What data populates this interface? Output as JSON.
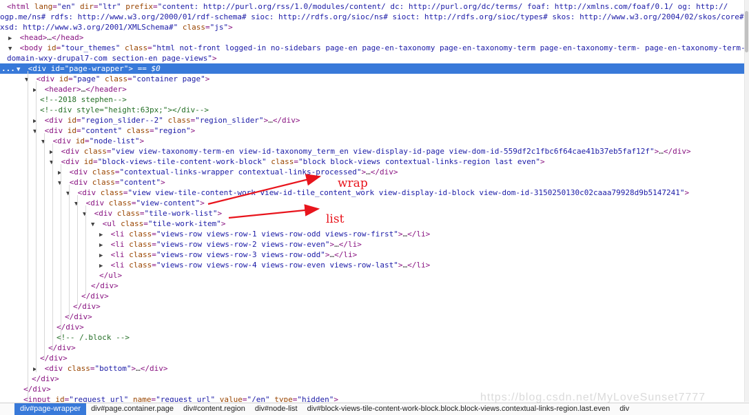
{
  "lines": [
    [
      {
        "c": "tag",
        "t": "<html "
      },
      {
        "c": "attr",
        "t": "lang"
      },
      {
        "c": "tag",
        "t": "="
      },
      {
        "c": "val",
        "t": "\"en\""
      },
      {
        "c": "attr",
        "t": " dir"
      },
      {
        "c": "tag",
        "t": "="
      },
      {
        "c": "val",
        "t": "\"ltr\""
      },
      {
        "c": "attr",
        "t": " prefix"
      },
      {
        "c": "tag",
        "t": "="
      },
      {
        "c": "val",
        "t": "\"content: http://purl.org/rss/1.0/modules/content/ dc: http://purl.org/dc/terms/ foaf: http://xmlns.com/foaf/0.1/ og: http://"
      }
    ],
    [
      {
        "c": "val",
        "t": "ogp.me/ns# rdfs: http://www.w3.org/2000/01/rdf-schema# sioc: http://rdfs.org/sioc/ns# sioct: http://rdfs.org/sioc/types# skos: http://www.w3.org/2004/02/skos/core#"
      }
    ],
    [
      {
        "c": "val",
        "t": "xsd: http://www.w3.org/2001/XMLSchema#\""
      },
      {
        "c": "attr",
        "t": " class"
      },
      {
        "c": "tag",
        "t": "="
      },
      {
        "c": "val",
        "t": "\"js\""
      },
      {
        "c": "tag",
        "t": ">"
      }
    ],
    [
      {
        "c": "tag",
        "t": "<head>"
      },
      {
        "c": "ell",
        "t": "…"
      },
      {
        "c": "tag",
        "t": "</head>"
      }
    ],
    [
      {
        "c": "tag",
        "t": "<body "
      },
      {
        "c": "attr",
        "t": "id"
      },
      {
        "c": "tag",
        "t": "="
      },
      {
        "c": "val",
        "t": "\"tour_themes\""
      },
      {
        "c": "attr",
        "t": " class"
      },
      {
        "c": "tag",
        "t": "="
      },
      {
        "c": "val",
        "t": "\"html not-front logged-in no-sidebars page-en page-en-taxonomy page-en-taxonomy-term page-en-taxonomy-term- page-en-taxonomy-term-55"
      }
    ],
    [
      {
        "c": "val",
        "t": "domain-wxy-drupal7-com section-en page-views\""
      },
      {
        "c": "tag",
        "t": ">"
      }
    ],
    [
      {
        "c": "tag",
        "t": "<div "
      },
      {
        "c": "attr",
        "t": "id"
      },
      {
        "c": "tag",
        "t": "="
      },
      {
        "c": "val",
        "t": "\"page-wrapper\""
      },
      {
        "c": "tag",
        "t": ">"
      },
      {
        "c": "dollar",
        "t": " == $0"
      }
    ],
    [
      {
        "c": "tag",
        "t": "<div "
      },
      {
        "c": "attr",
        "t": "id"
      },
      {
        "c": "tag",
        "t": "="
      },
      {
        "c": "val",
        "t": "\"page\""
      },
      {
        "c": "attr",
        "t": " class"
      },
      {
        "c": "tag",
        "t": "="
      },
      {
        "c": "val",
        "t": "\"container page\""
      },
      {
        "c": "tag",
        "t": ">"
      }
    ],
    [
      {
        "c": "tag",
        "t": "<header>"
      },
      {
        "c": "ell",
        "t": "…"
      },
      {
        "c": "tag",
        "t": "</header>"
      }
    ],
    [
      {
        "c": "cm",
        "t": "<!--2018 stephen-->"
      }
    ],
    [
      {
        "c": "cm",
        "t": "<!--div style=\"height:63px;\"></div-->"
      }
    ],
    [
      {
        "c": "tag",
        "t": "<div "
      },
      {
        "c": "attr",
        "t": "id"
      },
      {
        "c": "tag",
        "t": "="
      },
      {
        "c": "val",
        "t": "\"region_slider--2\""
      },
      {
        "c": "attr",
        "t": " class"
      },
      {
        "c": "tag",
        "t": "="
      },
      {
        "c": "val",
        "t": "\"region_slider\""
      },
      {
        "c": "tag",
        "t": ">"
      },
      {
        "c": "ell",
        "t": "…"
      },
      {
        "c": "tag",
        "t": "</div>"
      }
    ],
    [
      {
        "c": "tag",
        "t": "<div "
      },
      {
        "c": "attr",
        "t": "id"
      },
      {
        "c": "tag",
        "t": "="
      },
      {
        "c": "val",
        "t": "\"content\""
      },
      {
        "c": "attr",
        "t": " class"
      },
      {
        "c": "tag",
        "t": "="
      },
      {
        "c": "val",
        "t": "\"region\""
      },
      {
        "c": "tag",
        "t": ">"
      }
    ],
    [
      {
        "c": "tag",
        "t": "<div "
      },
      {
        "c": "attr",
        "t": "id"
      },
      {
        "c": "tag",
        "t": "="
      },
      {
        "c": "val",
        "t": "\"node-list\""
      },
      {
        "c": "tag",
        "t": ">"
      }
    ],
    [
      {
        "c": "tag",
        "t": "<div "
      },
      {
        "c": "attr",
        "t": "class"
      },
      {
        "c": "tag",
        "t": "="
      },
      {
        "c": "val",
        "t": "\"view view-taxonomy-term-en view-id-taxonomy_term_en view-display-id-page view-dom-id-559df2c1fbc6f64cae41b37eb5faf12f\""
      },
      {
        "c": "tag",
        "t": ">"
      },
      {
        "c": "ell",
        "t": "…"
      },
      {
        "c": "tag",
        "t": "</div>"
      }
    ],
    [
      {
        "c": "tag",
        "t": "<div "
      },
      {
        "c": "attr",
        "t": "id"
      },
      {
        "c": "tag",
        "t": "="
      },
      {
        "c": "val",
        "t": "\"block-views-tile-content-work-block\""
      },
      {
        "c": "attr",
        "t": " class"
      },
      {
        "c": "tag",
        "t": "="
      },
      {
        "c": "val",
        "t": "\"block block-views contextual-links-region last even\""
      },
      {
        "c": "tag",
        "t": ">"
      }
    ],
    [
      {
        "c": "tag",
        "t": "<div "
      },
      {
        "c": "attr",
        "t": "class"
      },
      {
        "c": "tag",
        "t": "="
      },
      {
        "c": "val",
        "t": "\"contextual-links-wrapper contextual-links-processed\""
      },
      {
        "c": "tag",
        "t": ">"
      },
      {
        "c": "ell",
        "t": "…"
      },
      {
        "c": "tag",
        "t": "</div>"
      }
    ],
    [
      {
        "c": "tag",
        "t": "<div "
      },
      {
        "c": "attr",
        "t": "class"
      },
      {
        "c": "tag",
        "t": "="
      },
      {
        "c": "val",
        "t": "\"content\""
      },
      {
        "c": "tag",
        "t": ">"
      }
    ],
    [
      {
        "c": "tag",
        "t": "<div "
      },
      {
        "c": "attr",
        "t": "class"
      },
      {
        "c": "tag",
        "t": "="
      },
      {
        "c": "val",
        "t": "\"view view-tile-content-work view-id-tile_content_work view-display-id-block view-dom-id-3150250130c02caaa79928d9b5147241\""
      },
      {
        "c": "tag",
        "t": ">"
      }
    ],
    [
      {
        "c": "tag",
        "t": "<div "
      },
      {
        "c": "attr",
        "t": "class"
      },
      {
        "c": "tag",
        "t": "="
      },
      {
        "c": "val",
        "t": "\"view-content\""
      },
      {
        "c": "tag",
        "t": ">"
      }
    ],
    [
      {
        "c": "tag",
        "t": "<div "
      },
      {
        "c": "attr",
        "t": "class"
      },
      {
        "c": "tag",
        "t": "="
      },
      {
        "c": "val",
        "t": "\"tile-work-list\""
      },
      {
        "c": "tag",
        "t": ">"
      }
    ],
    [
      {
        "c": "tag",
        "t": "<ul "
      },
      {
        "c": "attr",
        "t": "class"
      },
      {
        "c": "tag",
        "t": "="
      },
      {
        "c": "val",
        "t": "\"tile-work-item\""
      },
      {
        "c": "tag",
        "t": ">"
      }
    ],
    [
      {
        "c": "tag",
        "t": "<li "
      },
      {
        "c": "attr",
        "t": "class"
      },
      {
        "c": "tag",
        "t": "="
      },
      {
        "c": "val",
        "t": "\"views-row views-row-1 views-row-odd views-row-first\""
      },
      {
        "c": "tag",
        "t": ">"
      },
      {
        "c": "ell",
        "t": "…"
      },
      {
        "c": "tag",
        "t": "</li>"
      }
    ],
    [
      {
        "c": "tag",
        "t": "<li "
      },
      {
        "c": "attr",
        "t": "class"
      },
      {
        "c": "tag",
        "t": "="
      },
      {
        "c": "val",
        "t": "\"views-row views-row-2 views-row-even\""
      },
      {
        "c": "tag",
        "t": ">"
      },
      {
        "c": "ell",
        "t": "…"
      },
      {
        "c": "tag",
        "t": "</li>"
      }
    ],
    [
      {
        "c": "tag",
        "t": "<li "
      },
      {
        "c": "attr",
        "t": "class"
      },
      {
        "c": "tag",
        "t": "="
      },
      {
        "c": "val",
        "t": "\"views-row views-row-3 views-row-odd\""
      },
      {
        "c": "tag",
        "t": ">"
      },
      {
        "c": "ell",
        "t": "…"
      },
      {
        "c": "tag",
        "t": "</li>"
      }
    ],
    [
      {
        "c": "tag",
        "t": "<li "
      },
      {
        "c": "attr",
        "t": "class"
      },
      {
        "c": "tag",
        "t": "="
      },
      {
        "c": "val",
        "t": "\"views-row views-row-4 views-row-even views-row-last\""
      },
      {
        "c": "tag",
        "t": ">"
      },
      {
        "c": "ell",
        "t": "…"
      },
      {
        "c": "tag",
        "t": "</li>"
      }
    ],
    [
      {
        "c": "tag",
        "t": "</ul>"
      }
    ],
    [
      {
        "c": "tag",
        "t": "</div>"
      }
    ],
    [
      {
        "c": "tag",
        "t": "</div>"
      }
    ],
    [
      {
        "c": "tag",
        "t": "</div>"
      }
    ],
    [
      {
        "c": "tag",
        "t": "</div>"
      }
    ],
    [
      {
        "c": "tag",
        "t": "</div>"
      }
    ],
    [
      {
        "c": "cm",
        "t": "<!-- /.block -->"
      }
    ],
    [
      {
        "c": "tag",
        "t": "</div>"
      }
    ],
    [
      {
        "c": "tag",
        "t": "</div>"
      }
    ],
    [
      {
        "c": "tag",
        "t": "<div "
      },
      {
        "c": "attr",
        "t": "class"
      },
      {
        "c": "tag",
        "t": "="
      },
      {
        "c": "val",
        "t": "\"bottom\""
      },
      {
        "c": "tag",
        "t": ">"
      },
      {
        "c": "ell",
        "t": "…"
      },
      {
        "c": "tag",
        "t": "</div>"
      }
    ],
    [
      {
        "c": "tag",
        "t": "</div>"
      }
    ],
    [
      {
        "c": "tag",
        "t": "</div>"
      }
    ],
    [
      {
        "c": "tag",
        "t": "<input "
      },
      {
        "c": "attr",
        "t": "id"
      },
      {
        "c": "tag",
        "t": "="
      },
      {
        "c": "val",
        "t": "\"request_url\""
      },
      {
        "c": "attr",
        "t": " name"
      },
      {
        "c": "tag",
        "t": "="
      },
      {
        "c": "val",
        "t": "\"request_url\""
      },
      {
        "c": "attr",
        "t": " value"
      },
      {
        "c": "tag",
        "t": "="
      },
      {
        "c": "val",
        "t": "\"/en\""
      },
      {
        "c": "attr",
        "t": " type"
      },
      {
        "c": "tag",
        "t": "="
      },
      {
        "c": "val",
        "t": "\"hidden\""
      },
      {
        "c": "tag",
        "t": ">"
      }
    ]
  ],
  "selected_marker": "...",
  "breadcrumbs": [
    "div#page-wrapper",
    "div#page.container.page",
    "div#content.region",
    "div#node-list",
    "div#block-views-tile-content-work-block.block.block-views.contextual-links-region.last.even",
    "div"
  ],
  "annotations": {
    "wrap": "wrap",
    "list": "list"
  },
  "watermark": "https://blog.csdn.net/MyLoveSunset7777",
  "colors": {
    "tag": "#881280",
    "attr": "#994500",
    "value": "#1a1aa6",
    "comment": "#236e25",
    "selection": "#3879d9",
    "annotation": "#e8141c"
  }
}
